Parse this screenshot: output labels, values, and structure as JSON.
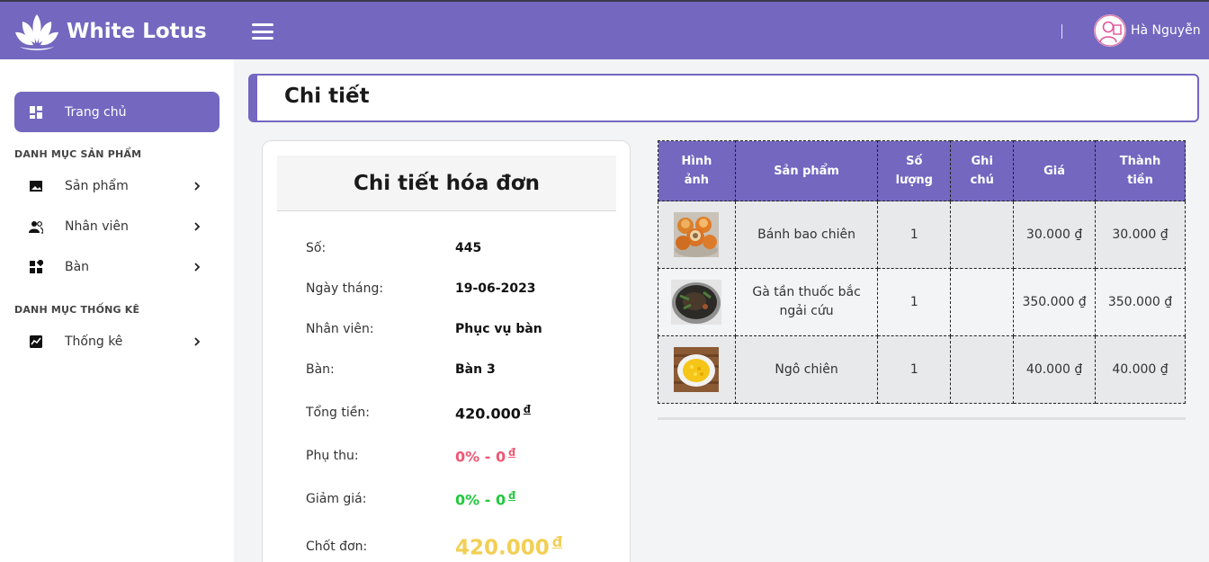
{
  "header": {
    "brand": "White Lotus",
    "user_name": "Hà Nguyễn"
  },
  "sidebar": {
    "home": "Trang chủ",
    "sections": [
      {
        "title": "DANH MỤC SẢN PHẨM",
        "items": [
          {
            "label": "Sản phẩm",
            "icon": "image-icon"
          },
          {
            "label": "Nhân viên",
            "icon": "users-icon"
          },
          {
            "label": "Bàn",
            "icon": "grid-icon"
          }
        ]
      },
      {
        "title": "DANH MỤC THỐNG KÊ",
        "items": [
          {
            "label": "Thống kê",
            "icon": "chart-icon"
          }
        ]
      }
    ]
  },
  "page": {
    "title": "Chi tiết"
  },
  "invoice": {
    "title": "Chi tiết hóa đơn",
    "rows": [
      {
        "key": "Số:",
        "value": "445"
      },
      {
        "key": "Ngày tháng:",
        "value": "19-06-2023"
      },
      {
        "key": "Nhân viên:",
        "value": "Phục vụ bàn"
      },
      {
        "key": "Bàn:",
        "value": "Bàn 3"
      },
      {
        "key": "Tổng tiền:",
        "value": "420.000",
        "currency": "đ"
      },
      {
        "key": "Phụ thu:",
        "value": "0% - 0",
        "currency": "đ"
      },
      {
        "key": "Giảm giá:",
        "value": "0% - 0",
        "currency": "đ"
      },
      {
        "key": "Chốt đơn:",
        "value": "420.000",
        "currency": "đ"
      }
    ]
  },
  "table": {
    "headers": [
      "Hình ảnh",
      "Sản phẩm",
      "Số lượng",
      "Ghi chú",
      "Giá",
      "Thành tiền"
    ],
    "rows": [
      {
        "product": "Bánh bao chiên",
        "qty": "1",
        "note": "",
        "price": "30.000 ₫",
        "total": "30.000 ₫",
        "image": "fried-buns-photo"
      },
      {
        "product": "Gà tần thuốc bắc ngải cứu",
        "qty": "1",
        "note": "",
        "price": "350.000 ₫",
        "total": "350.000 ₫",
        "image": "herbal-chicken-photo"
      },
      {
        "product": "Ngô chiên",
        "qty": "1",
        "note": "",
        "price": "40.000 ₫",
        "total": "40.000 ₫",
        "image": "fried-corn-photo"
      }
    ]
  },
  "colors": {
    "accent": "#7367c0",
    "surcharge": "#ef5774",
    "discount": "#21c93d",
    "final": "#f2cf54"
  }
}
